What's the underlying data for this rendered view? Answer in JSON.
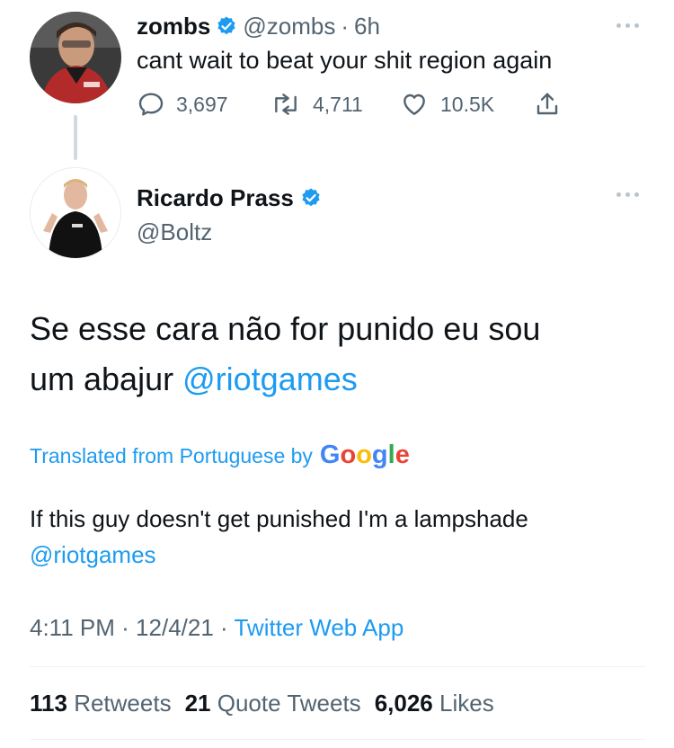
{
  "reply_tweet": {
    "name": "zombs",
    "handle": "@zombs",
    "separator": "·",
    "time": "6h",
    "text": "cant wait to beat your shit region again",
    "replies": "3,697",
    "retweets": "4,711",
    "likes": "10.5K"
  },
  "main_tweet": {
    "name": "Ricardo Prass",
    "handle": "@Boltz",
    "text_line1": "Se esse cara não for punido eu sou",
    "text_line2_prefix": "um abajur",
    "text_mention": "@riotgames",
    "translated_label": "Translated from Portuguese by",
    "google_letters": [
      "G",
      "o",
      "o",
      "g",
      "l",
      "e"
    ],
    "translation_line1": "If this guy doesn't get punished I'm a lampshade",
    "translation_mention": "@riotgames",
    "timestamp": "4:11 PM",
    "date": "12/4/21",
    "separator": "·",
    "source": "Twitter Web App"
  },
  "stats": {
    "retweets_count": "113",
    "retweets_label": "Retweets",
    "quotes_count": "21",
    "quotes_label": "Quote Tweets",
    "likes_count": "6,026",
    "likes_label": "Likes"
  },
  "colors": {
    "accent": "#1d9bf0",
    "muted": "#536471",
    "google": [
      "#4285f4",
      "#ea4335",
      "#fbbc05",
      "#4285f4",
      "#34a853",
      "#ea4335"
    ]
  }
}
